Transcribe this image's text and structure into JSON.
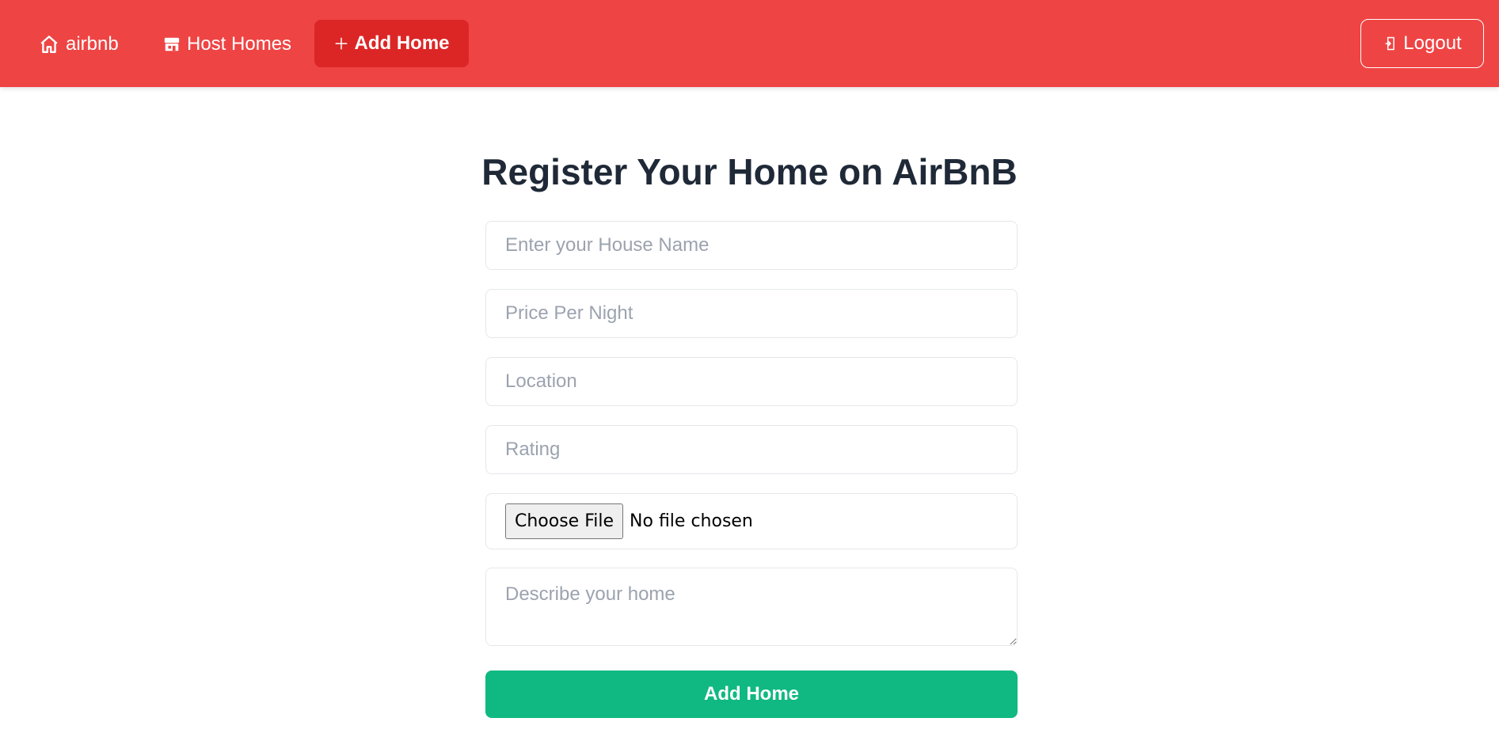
{
  "nav": {
    "brand_label": "airbnb",
    "brand_icon": "house-icon",
    "host_homes_label": "Host Homes",
    "host_homes_icon": "store-icon",
    "add_home_label": "Add Home",
    "add_home_icon": "plus-icon",
    "logout_label": "Logout",
    "logout_icon": "logout-icon",
    "bg_color": "#ef4444",
    "active_color": "#dc2626"
  },
  "form": {
    "title": "Register Your Home on AirBnB",
    "house_name_placeholder": "Enter your House Name",
    "price_placeholder": "Price Per Night",
    "location_placeholder": "Location",
    "rating_placeholder": "Rating",
    "file_button_label": "Choose File",
    "file_status": "No file chosen",
    "description_placeholder": "Describe your home",
    "submit_label": "Add Home",
    "submit_color": "#10b981"
  }
}
